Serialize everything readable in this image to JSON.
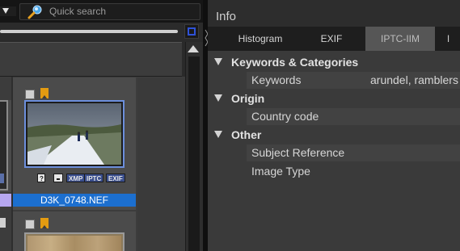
{
  "browser": {
    "search": {
      "placeholder": "Quick search"
    },
    "selected_file": {
      "filename": "D3K_0748.NEF"
    },
    "badges": {
      "question": "?",
      "xmp": "XMP",
      "iptc": "IPTC",
      "exif": "EXIF"
    }
  },
  "info": {
    "title": "Info",
    "tabs": [
      {
        "label": "Histogram"
      },
      {
        "label": "EXIF"
      },
      {
        "label": "IPTC-IIM",
        "selected": true
      },
      {
        "label": "I"
      }
    ],
    "categories": [
      {
        "label": "Keywords & Categories",
        "fields": [
          {
            "label": "Keywords",
            "value": "arundel, ramblers"
          }
        ]
      },
      {
        "label": "Origin",
        "fields": [
          {
            "label": "Country code",
            "value": ""
          }
        ]
      },
      {
        "label": "Other",
        "fields": [
          {
            "label": "Subject Reference",
            "value": ""
          },
          {
            "label": "Image Type",
            "value": ""
          }
        ]
      }
    ]
  },
  "colors": {
    "selection_blue": "#1c6fcf",
    "flag_orange": "#e39b11",
    "thumb_border": "#6c8fdc",
    "active_tab": "#565656"
  }
}
